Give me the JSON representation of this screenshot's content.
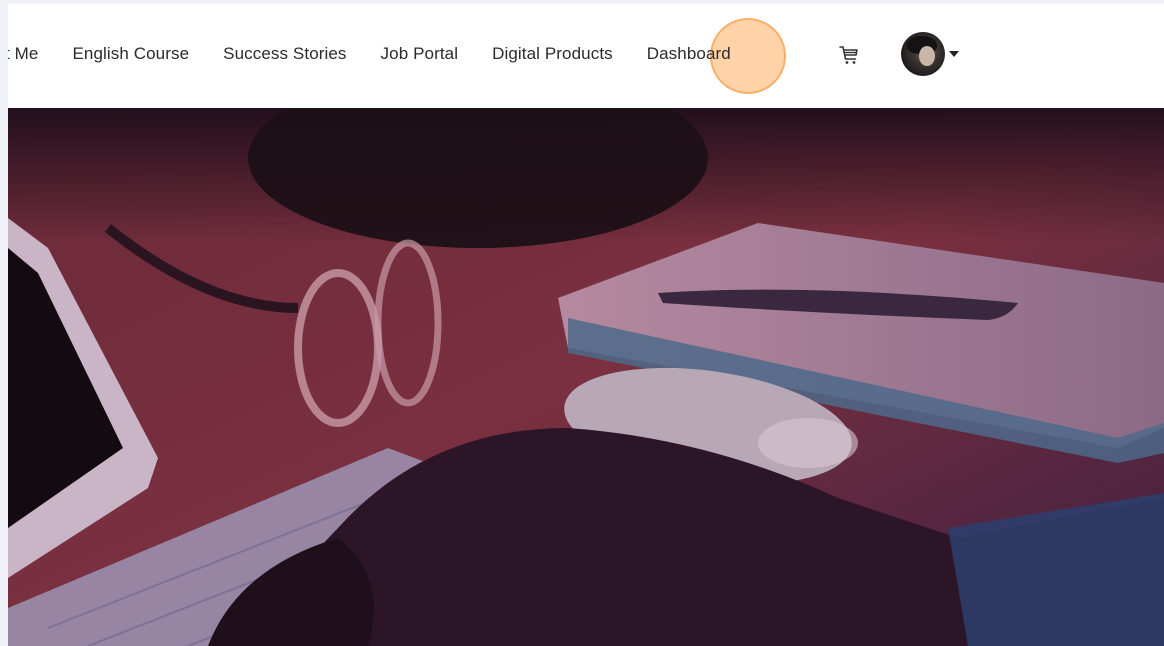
{
  "nav": {
    "items": [
      {
        "label": "t Me"
      },
      {
        "label": "English Course"
      },
      {
        "label": "Success Stories"
      },
      {
        "label": "Job Portal"
      },
      {
        "label": "Digital Products"
      },
      {
        "label": "Dashboard"
      }
    ]
  },
  "icons": {
    "cart": "cart-icon",
    "avatar": "user-avatar",
    "caret": "chevron-down-icon"
  },
  "colors": {
    "highlight": "#ffba78",
    "nav_text": "#2b2b2b",
    "hero_tint": "#5a1f3a"
  }
}
